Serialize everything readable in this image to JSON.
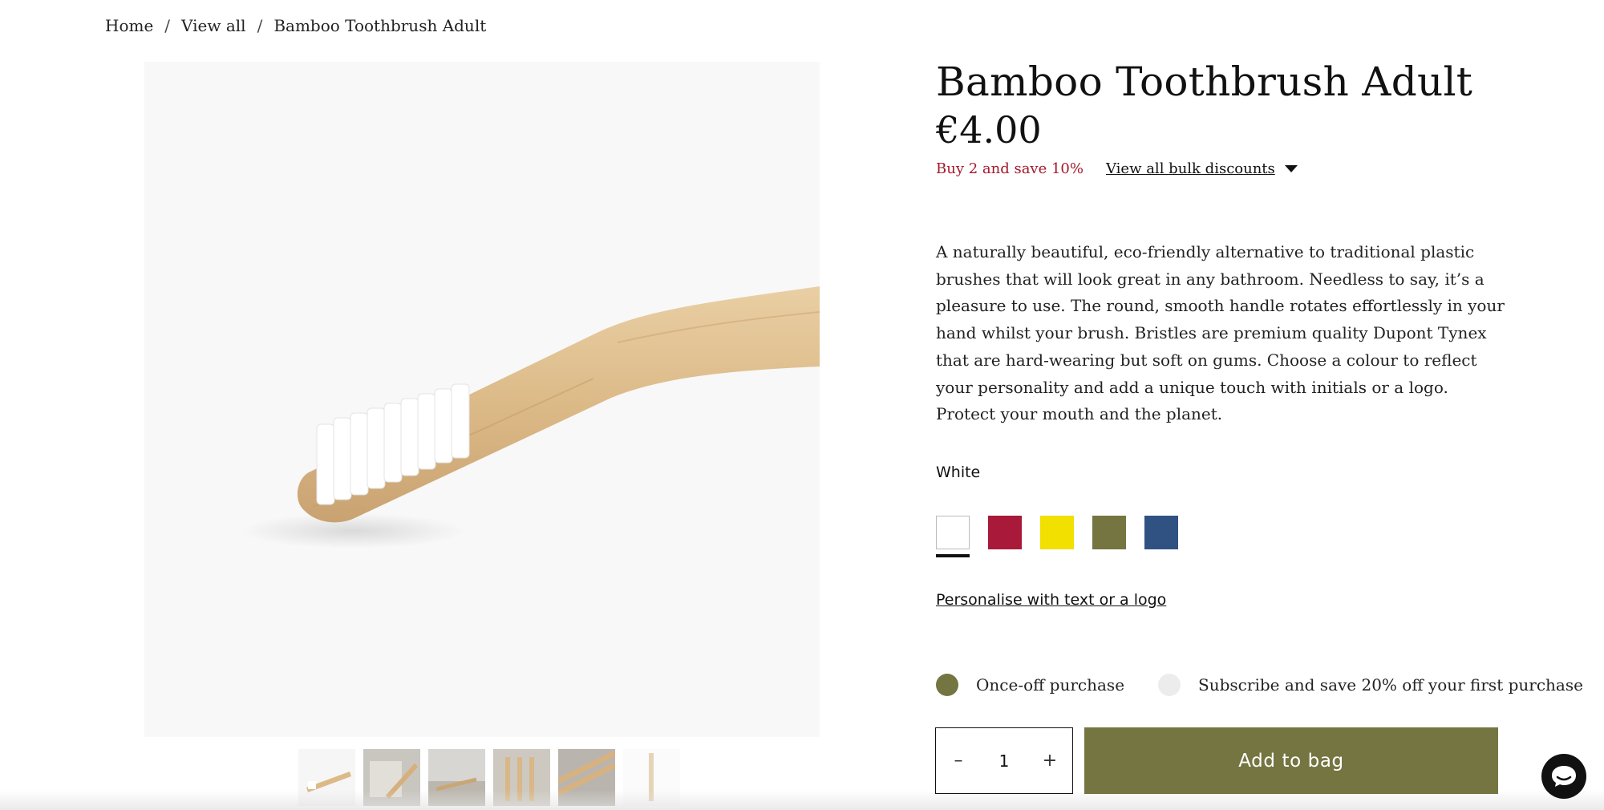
{
  "breadcrumb": {
    "home": "Home",
    "sep1": "/",
    "view_all": "View all",
    "sep2": "/",
    "current": "Bamboo Toothbrush Adult"
  },
  "product": {
    "title": "Bamboo Toothbrush Adult",
    "price": "€4.00",
    "bulk_save": "Buy 2 and save 10%",
    "bulk_link": "View all bulk discounts",
    "description": "A naturally beautiful, eco-friendly alternative to traditional plastic brushes that will look great in any bathroom. Needless to say, it’s a pleasure to use. The round, smooth handle rotates effortlessly in your hand whilst your brush. Bristles are premium quality Dupont Tynex that are hard-wearing but soft on gums. Choose a colour to reflect your personality and add a unique touch with initials or a logo. Protect your mouth and the planet."
  },
  "colour": {
    "selected_label": "White",
    "swatches": [
      {
        "name": "White",
        "hex": "#ffffff"
      },
      {
        "name": "Red",
        "hex": "#a8193a"
      },
      {
        "name": "Yellow",
        "hex": "#f1e000"
      },
      {
        "name": "Olive",
        "hex": "#747541"
      },
      {
        "name": "Blue",
        "hex": "#2f5283"
      }
    ]
  },
  "personalise_link": "Personalise with text or a logo",
  "purchase": {
    "once_off": "Once-off purchase",
    "subscribe": "Subscribe and save 20% off your first purchase",
    "selected": "once_off"
  },
  "quantity": {
    "minus": "–",
    "value": "1",
    "plus": "+"
  },
  "add_to_bag": "Add to bag",
  "colors": {
    "accent": "#747541",
    "sale_red": "#a3192c"
  }
}
